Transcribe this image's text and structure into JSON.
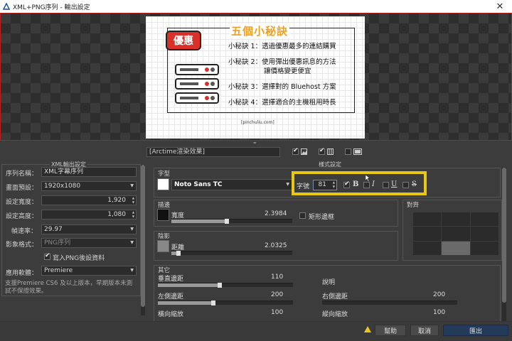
{
  "window": {
    "title": "XML+PNG序列 - 輸出設定",
    "close_glyph": "✕"
  },
  "preview": {
    "badge": "優惠",
    "headline": "五個小秘訣",
    "tips": [
      "小秘訣 1：透過優惠最多的連結購買",
      "小秘訣 2：使用彈出優惠訊息的方法",
      "讓價格變更便宜",
      "小秘訣 3：選擇對的 Bluehost 方案",
      "小秘訣 4：選擇適合的主機租用時長"
    ],
    "footer": "[pinchuliu.com]"
  },
  "left": {
    "group_title": "XML輸出設定",
    "sequence_name_label": "序列名稱：",
    "sequence_name_value": "XML字幕序列",
    "preset_label": "畫面預設：",
    "preset_value": "1920x1080",
    "width_label": "設定寬度：",
    "width_value": "1,920",
    "height_label": "設定高度：",
    "height_value": "1,080",
    "fps_label": "幀速率：",
    "fps_value": "29.97",
    "format_label": "影象格式：",
    "format_value": "PNG序列",
    "write_png_label": "寫入PNG後設資料",
    "write_png_checked": true,
    "app_label": "應用軟體：",
    "app_value": "Premiere",
    "note": "支援Premiere CS6 及以上版本，早期版本未測試不保證效果。"
  },
  "right": {
    "effect_field": "[Arctime渲染效果]",
    "style_title": "樣式設定",
    "font_group": "字型",
    "font_name": "Noto Sans TC",
    "size_label": "字號",
    "size_value": "81",
    "bold_label": "B",
    "italic_label": "I",
    "underline_label": "U",
    "strike_label": "S",
    "bold_checked": true,
    "stroke_group": "描邊",
    "stroke_width_label": "寬度",
    "stroke_width_value": "2.3984",
    "stroke_width_level": 0.46,
    "rect_border_label": "矩形邊框",
    "shadow_group": "陰影",
    "shadow_dist_label": "距離",
    "shadow_dist_value": "2.0325",
    "shadow_dist_level": 0.06,
    "align_group": "對齊",
    "other_group": "其它",
    "vmargin_label": "垂直邊距",
    "vmargin_value": "110",
    "vmargin_level": 0.46,
    "lmargin_label": "左側邊距",
    "lmargin_value": "200",
    "lmargin_level": 0.41,
    "hscale_label": "橫向縮放",
    "hscale_value": "100",
    "desc_label": "說明",
    "rmargin_label": "右側邊距",
    "rmargin_value": "200",
    "vscale_label": "縱向縮放",
    "vscale_value": "100"
  },
  "footer": {
    "help": "幫助",
    "cancel": "取消",
    "export": "匯出"
  },
  "colors": {
    "highlight": "#e8c717",
    "preview_border": "#b32222",
    "badge": "#d9302a",
    "headline": "#f0a020"
  }
}
